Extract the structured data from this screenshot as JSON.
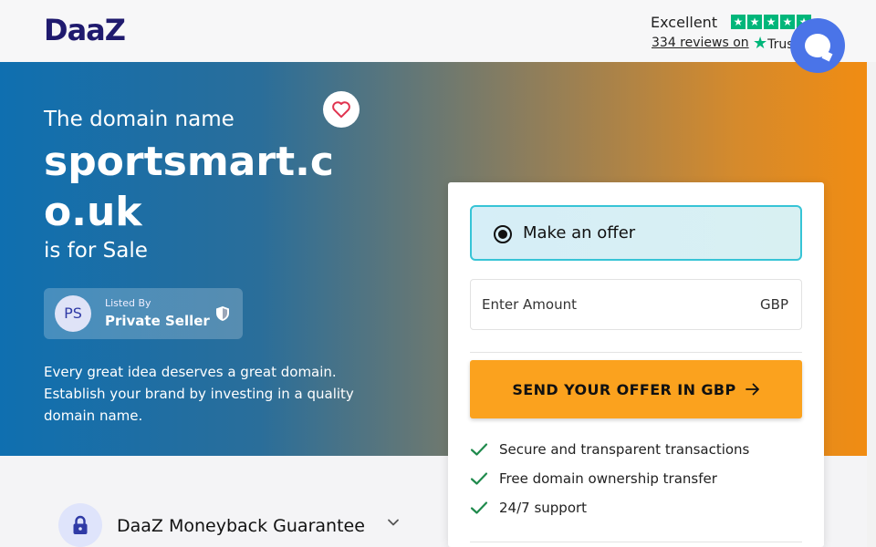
{
  "brand": {
    "logo": "DaaZ"
  },
  "trustpilot": {
    "rating_text": "Excellent",
    "stars": 5,
    "reviews_text": "334 reviews on",
    "logo_text": "Trus",
    "star_color": "#00b67a"
  },
  "hero": {
    "intro": "The domain name",
    "domain": "sportsmart.co.uk",
    "suffix": "is for Sale",
    "description": "Every great idea deserves a great domain. Establish your brand by investing in a quality domain name."
  },
  "seller": {
    "initials": "PS",
    "label": "Listed By",
    "name": "Private Seller"
  },
  "offer": {
    "option_label": "Make an offer",
    "amount_placeholder": "Enter Amount",
    "currency": "GBP",
    "button_label": "SEND YOUR OFFER IN GBP",
    "button_color": "#fba21e",
    "features": [
      "Secure and transparent transactions",
      "Free domain ownership transfer",
      "24/7 support"
    ]
  },
  "guarantee": {
    "title": "DaaZ Moneyback Guarantee"
  },
  "colors": {
    "accent": "#4a74e8",
    "brand": "#1f1a6e",
    "check": "#1f8a4c"
  }
}
